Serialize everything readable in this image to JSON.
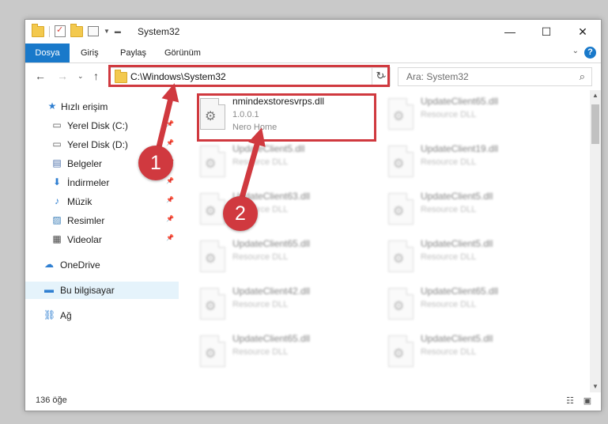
{
  "window": {
    "title": "System32",
    "controls": {
      "minimize": "—",
      "maximize": "☐",
      "close": "✕"
    }
  },
  "ribbon": {
    "tabs": [
      "Dosya",
      "Giriş",
      "Paylaş",
      "Görünüm"
    ],
    "help": "?"
  },
  "navigation": {
    "address": "C:\\Windows\\System32",
    "search_placeholder": "Ara: System32"
  },
  "sidebar": {
    "items": [
      {
        "label": "Hızlı erişim",
        "icon": "star-icon",
        "pinned": false
      },
      {
        "label": "Yerel Disk (C:)",
        "icon": "drive-icon",
        "pinned": true
      },
      {
        "label": "Yerel Disk (D:)",
        "icon": "drive-icon",
        "pinned": true
      },
      {
        "label": "Belgeler",
        "icon": "document-icon",
        "pinned": true
      },
      {
        "label": "İndirmeler",
        "icon": "download-icon",
        "pinned": true
      },
      {
        "label": "Müzik",
        "icon": "music-icon",
        "pinned": true
      },
      {
        "label": "Resimler",
        "icon": "pictures-icon",
        "pinned": true
      },
      {
        "label": "Videolar",
        "icon": "video-icon",
        "pinned": true
      },
      {
        "label": "OneDrive",
        "icon": "cloud-icon",
        "pinned": false
      },
      {
        "label": "Bu bilgisayar",
        "icon": "computer-icon",
        "pinned": false,
        "selected": true
      },
      {
        "label": "Ağ",
        "icon": "network-icon",
        "pinned": false
      }
    ]
  },
  "files": [
    {
      "name": "nmindexstoresvrps.dll",
      "line2": "1.0.0.1",
      "line3": "Nero Home"
    },
    {
      "name": "UpdateClient65.dll",
      "line2": "Resource DLL"
    },
    {
      "name": "UpdateClient5.dll",
      "line2": "Resource DLL"
    },
    {
      "name": "UpdateClient19.dll",
      "line2": "Resource DLL"
    },
    {
      "name": "UpdateClient63.dll",
      "line2": "Resource DLL"
    },
    {
      "name": "UpdateClient5.dll",
      "line2": "Resource DLL"
    },
    {
      "name": "UpdateClient65.dll",
      "line2": "Resource DLL"
    },
    {
      "name": "UpdateClient5.dll",
      "line2": "Resource DLL"
    },
    {
      "name": "UpdateClient42.dll",
      "line2": "Resource DLL"
    },
    {
      "name": "UpdateClient65.dll",
      "line2": "Resource DLL"
    },
    {
      "name": "UpdateClient65.dll",
      "line2": "Resource DLL"
    },
    {
      "name": "UpdateClient5.dll",
      "line2": "Resource DLL"
    }
  ],
  "status": {
    "count": "136 öğe"
  },
  "annotations": {
    "badge1": "1",
    "badge2": "2",
    "color": "#d0393f"
  }
}
